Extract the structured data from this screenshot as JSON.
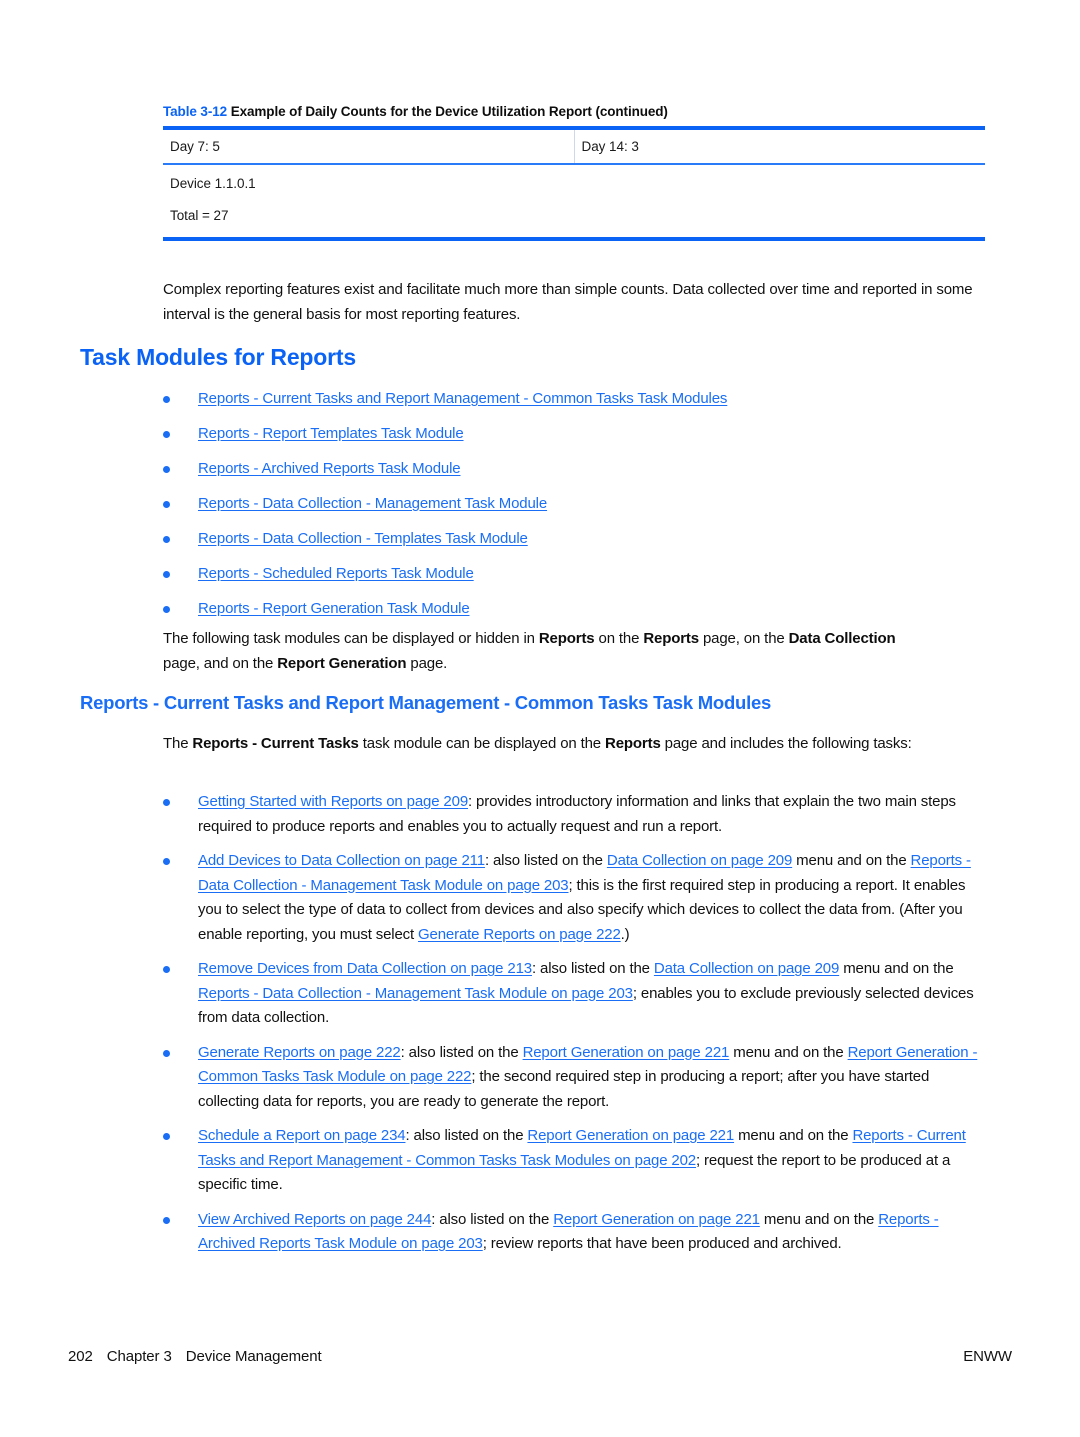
{
  "table": {
    "caption_number": "Table 3-12",
    "caption_title": "Example of Daily Counts for the Device Utilization Report (continued)",
    "rows": [
      {
        "col_a": "Day 7: 5",
        "col_b": "Day 14: 3"
      }
    ],
    "summary_lines": [
      "Device 1.1.0.1",
      "Total = 27"
    ]
  },
  "intro_paragraph": "Complex reporting features exist and facilitate much more than simple counts. Data collected over time and reported in some interval is the general basis for most reporting features.",
  "heading_task_modules": "Task Modules for Reports",
  "task_module_links": [
    "Reports - Current Tasks and Report Management - Common Tasks Task Modules",
    "Reports - Report Templates Task Module",
    "Reports - Archived Reports Task Module",
    "Reports - Data Collection - Management Task Module",
    "Reports - Data Collection - Templates Task Module",
    "Reports - Scheduled Reports Task Module",
    "Reports - Report Generation Task Module"
  ],
  "displayed_hidden_paragraph": {
    "part1": "The following task modules can be displayed or hidden in ",
    "bold1": "Reports",
    "part2": " on the ",
    "bold2": "Reports",
    "part3": " page, on the ",
    "bold3": "Data Collection",
    "part4": " page, and on the ",
    "bold4": "Report Generation",
    "part5": " page."
  },
  "heading_common_tasks": "Reports - Current Tasks and Report Management - Common Tasks Task Modules",
  "common_tasks_intro": {
    "part1": "The ",
    "bold1": "Reports - Current Tasks",
    "part2": " task module can be displayed on the ",
    "bold2": "Reports",
    "part3": " page and includes the following tasks:"
  },
  "tasks": [
    {
      "link1": "Getting Started with Reports on page 209",
      "text1": ": provides introductory information and links that explain the two main steps required to produce reports and enables you to actually request and run a report."
    },
    {
      "link1": "Add Devices to Data Collection on page 211",
      "text1": ": also listed on the ",
      "link2": "Data Collection on page 209",
      "text2": " menu and on the ",
      "link3": "Reports - Data Collection - Management Task Module on page 203",
      "text3": "; this is the first required step in producing a report. It enables you to select the type of data to collect from devices and also specify which devices to collect the data from. (After you enable reporting, you must select ",
      "link4": "Generate Reports on page 222",
      "text4": ".)"
    },
    {
      "link1": "Remove Devices from Data Collection on page 213",
      "text1": ": also listed on the ",
      "link2": "Data Collection on page 209",
      "text2": " menu and on the ",
      "link3": "Reports - Data Collection - Management Task Module on page 203",
      "text3": "; enables you to exclude previously selected devices from data collection."
    },
    {
      "link1": "Generate Reports on page 222",
      "text1": ": also listed on the ",
      "link2": "Report Generation on page 221",
      "text2": " menu and on the ",
      "link3": "Report Generation - Common Tasks Task Module on page 222",
      "text3": "; the second required step in producing a report; after you have started collecting data for reports, you are ready to generate the report."
    },
    {
      "link1": "Schedule a Report on page 234",
      "text1": ": also listed on the ",
      "link2": "Report Generation on page 221",
      "text2": " menu and on the ",
      "link3": "Reports - Current Tasks and Report Management - Common Tasks Task Modules on page 202",
      "text3": "; request the report to be produced at a specific time."
    },
    {
      "link1": "View Archived Reports on page 244",
      "text1": ": also listed on the ",
      "link2": "Report Generation on page 221",
      "text2": " menu and on the ",
      "link3": "Reports - Archived Reports Task Module on page 203",
      "text3": "; review reports that have been produced and archived."
    }
  ],
  "footer": {
    "page_number": "202",
    "chapter": "Chapter 3",
    "chapter_title": "Device Management",
    "right_label": "ENWW"
  },
  "colors": {
    "accent_blue": "#0a63f5",
    "link_blue": "#1a6ef5",
    "body_text": "#111111"
  }
}
